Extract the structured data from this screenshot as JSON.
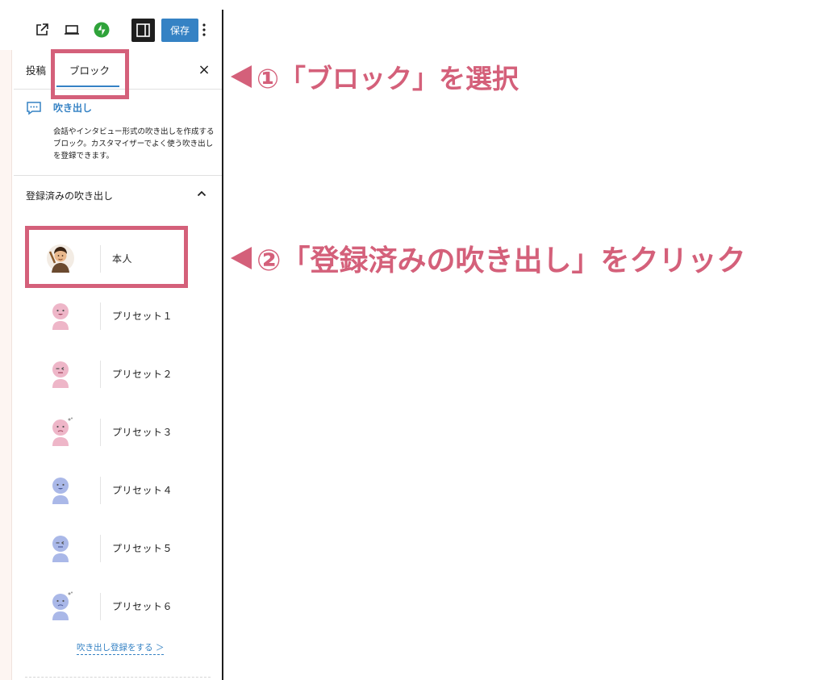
{
  "toolbar": {
    "save_label": "保存",
    "icons": [
      "external-link-icon",
      "laptop-preview-icon",
      "jetpack-icon",
      "sidebar-toggle-icon",
      "more-vertical-icon"
    ]
  },
  "sidebar": {
    "tabs": [
      {
        "label": "投稿",
        "active": false
      },
      {
        "label": "ブロック",
        "active": true
      }
    ],
    "close_label": "×",
    "block": {
      "title": "吹き出し",
      "description": "会話やインタビュー形式の吹き出しを作成するブロック。カスタマイザーでよく使う吹き出しを登録できます。"
    },
    "panel": {
      "title": "登録済みの吹き出し",
      "expanded": true,
      "items": [
        {
          "label": "本人",
          "avatar": "person-photo-icon",
          "color": "#c98a5a"
        },
        {
          "label": "プリセット１",
          "avatar": "preset-pink-smile-icon",
          "color": "#eeb6c8"
        },
        {
          "label": "プリセット２",
          "avatar": "preset-pink-wink-icon",
          "color": "#eeb6c8"
        },
        {
          "label": "プリセット３",
          "avatar": "preset-pink-worried-icon",
          "color": "#eeb6c8"
        },
        {
          "label": "プリセット４",
          "avatar": "preset-blue-smile-icon",
          "color": "#aab8e8"
        },
        {
          "label": "プリセット５",
          "avatar": "preset-blue-wink-icon",
          "color": "#aab8e8"
        },
        {
          "label": "プリセット６",
          "avatar": "preset-blue-worried-icon",
          "color": "#aab8e8"
        }
      ],
      "register_link": "吹き出し登録をする ＞"
    }
  },
  "annotations": {
    "step1": "①「ブロック」を選択",
    "step2": "②「登録済みの吹き出し」をクリック",
    "color": "#d4607a"
  },
  "colors": {
    "accent": "#3582c4",
    "highlight": "#d4607a"
  }
}
